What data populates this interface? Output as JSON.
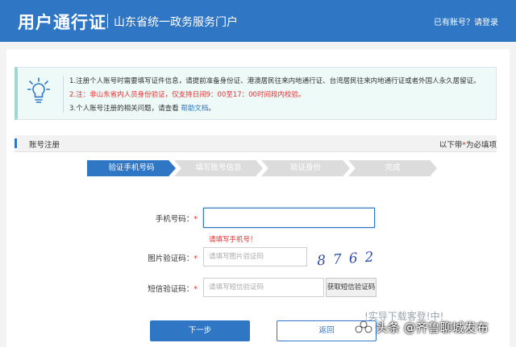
{
  "header": {
    "brand": "用户通行证",
    "subtitle": "山东省统一政务服务门户",
    "login_link": "已有账号？请登录"
  },
  "notice": {
    "icon": "lightbulb-icon",
    "line1": "1.注册个人账号时需要填写证件信息，请提前准备身份证、港澳居民往来内地通行证、台湾居民往来内地通行证或者外国人永久居留证。",
    "line2": "2.注：非山东省内人员身份验证，仅支持日间9：00至17：00时间段内校验。",
    "line3_prefix": "3.个人账号注册的相关问题，请查看",
    "help_link": "帮助文档",
    "line3_suffix": "。"
  },
  "section": {
    "title": "账号注册",
    "required_prefix": "以下带",
    "required_star": "*",
    "required_suffix": "为必填项"
  },
  "steps": [
    "验证手机号码",
    "填写账号信息",
    "验证身份",
    "完成"
  ],
  "form": {
    "phone_label": "手机号码：",
    "phone_value": "",
    "phone_error": "请填写手机号！",
    "captcha_label": "图片验证码：",
    "captcha_placeholder": "请填写图片验证码",
    "captcha_text": "8762",
    "sms_label": "短信验证码：",
    "sms_placeholder": "请填写短信验证码",
    "sms_button": "获取短信验证码",
    "required_mark": "*"
  },
  "buttons": {
    "next": "下一步",
    "back": "返回"
  },
  "overlay": {
    "ghost_text": "!实导下载客登!中!",
    "watermark": "头条 @齐鲁聊城发布"
  },
  "colors": {
    "primary": "#2f76c5",
    "error": "#e13131"
  }
}
